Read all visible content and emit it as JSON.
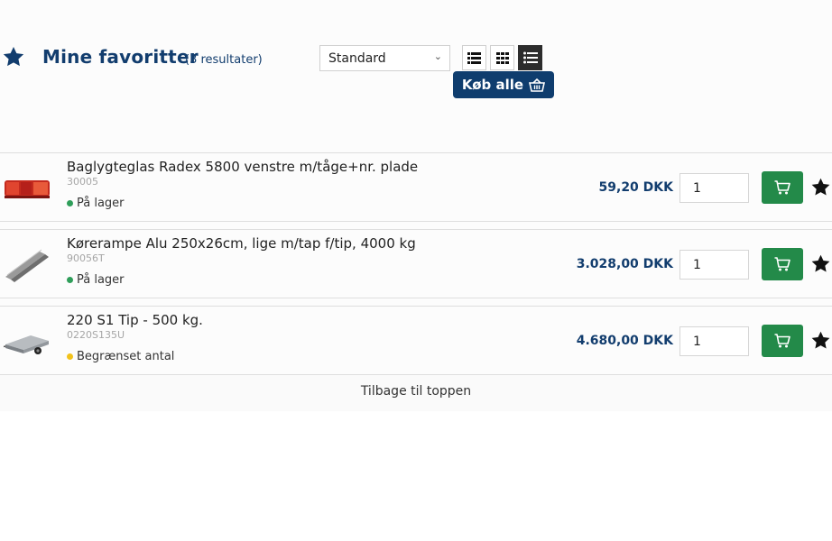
{
  "header": {
    "title": "Mine favoritter",
    "result_count": "(3 resultater)",
    "sort_value": "Standard",
    "buy_all_label": "Køb alle"
  },
  "colors": {
    "brand_blue": "#123d6e",
    "button_blue": "#0f3d6e",
    "cart_green": "#238a49",
    "in_stock": "#2f9e5a",
    "limited_stock": "#f2c21b"
  },
  "icons": {
    "favorites": "star-icon",
    "view_list": "list-view-icon",
    "view_grid": "grid-view-icon",
    "view_detail": "detail-list-view-icon",
    "buy_all": "basket-icon",
    "add_to_cart": "cart-icon",
    "favorite_toggle": "star-icon"
  },
  "products": [
    {
      "name": "Baglygteglas Radex 5800 venstre m/tåge+nr. plade",
      "sku": "30005",
      "stock": "På lager",
      "stock_status": "in_stock",
      "price": "59,20 DKK",
      "quantity": "1"
    },
    {
      "name": "Kørerampe Alu 250x26cm, lige m/tap f/tip, 4000 kg",
      "sku": "90056T",
      "stock": "På lager",
      "stock_status": "in_stock",
      "price": "3.028,00 DKK",
      "quantity": "1"
    },
    {
      "name": "220 S1 Tip - 500 kg.",
      "sku": "0220S135U",
      "stock": "Begrænset antal",
      "stock_status": "limited",
      "price": "4.680,00 DKK",
      "quantity": "1"
    }
  ],
  "footer": {
    "back_to_top": "Tilbage til toppen"
  }
}
